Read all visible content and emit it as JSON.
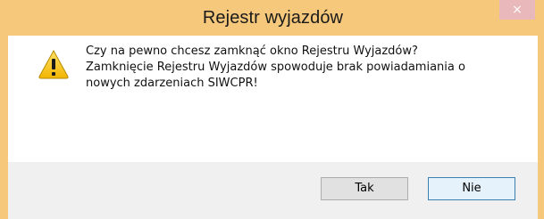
{
  "window": {
    "title": "Rejestr wyjazdów",
    "close_glyph": "×",
    "accent_color": "#f6c87c"
  },
  "message": {
    "icon": "warning-icon",
    "lines": [
      "Czy na pewno chcesz zamknąć okno Rejestru Wyjazdów?",
      "Zamknięcie Rejestru Wyjazdów spowoduje brak powiadamiania o",
      "nowych zdarzeniach SIWCPR!"
    ]
  },
  "buttons": {
    "yes_label": "Tak",
    "no_label": "Nie"
  }
}
